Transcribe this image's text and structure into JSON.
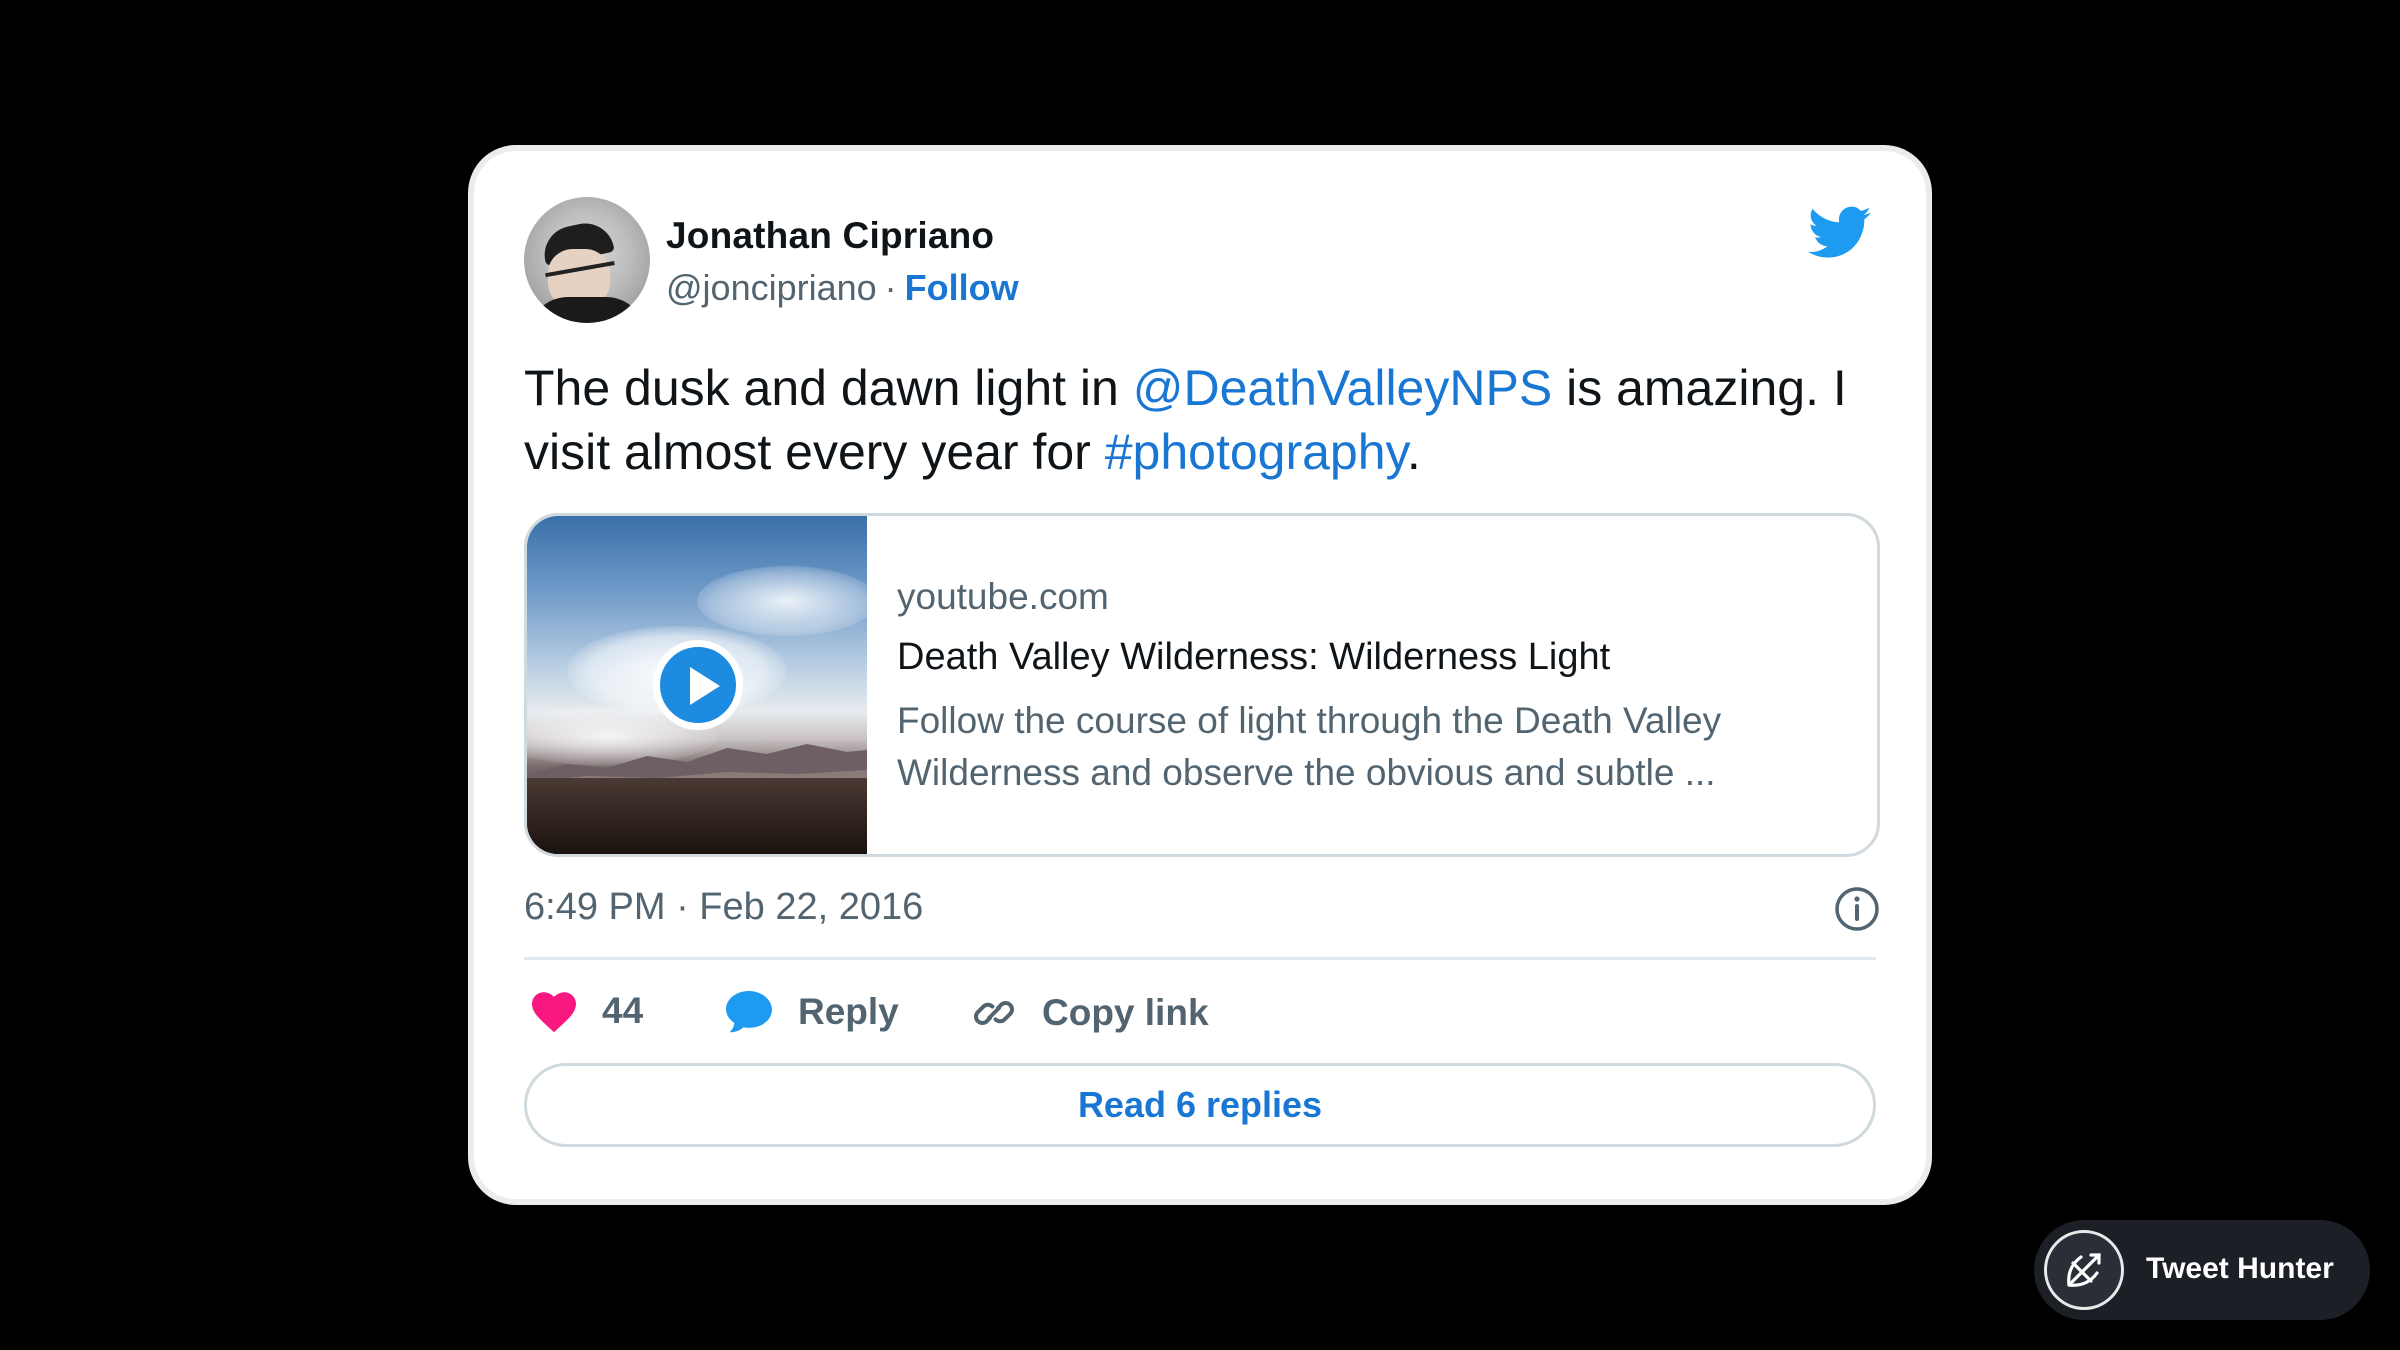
{
  "tweet": {
    "author_name": "Jonathan Cipriano",
    "handle": "@joncipriano",
    "separator": "·",
    "follow_label": "Follow",
    "text_part1": "The dusk and dawn light in ",
    "mention": "@DeathValleyNPS",
    "text_part2": " is amazing. I visit almost every year for ",
    "hashtag": "#photography",
    "text_part3": ".",
    "timestamp": "6:49 PM · Feb 22, 2016",
    "likes_count": "44",
    "reply_label": "Reply",
    "copy_link_label": "Copy link",
    "read_replies_label": "Read 6 replies"
  },
  "preview": {
    "domain": "youtube.com",
    "title": "Death Valley Wilderness: Wilderness Light",
    "description": "Follow the course of light through the Death Valley Wilderness and observe the obvious and subtle ..."
  },
  "branding": {
    "badge_label": "Tweet Hunter"
  },
  "icons": {
    "twitter": "twitter-bird-icon",
    "play": "play-icon",
    "info": "info-icon",
    "like": "heart-icon",
    "reply": "speech-bubble-icon",
    "copy": "link-icon",
    "badge": "tweet-hunter-logo-icon"
  },
  "colors": {
    "background": "#000000",
    "card": "#ffffff",
    "link_blue": "#1976d2",
    "twitter_blue": "#1d9bf0",
    "heart_pink": "#f91880",
    "muted_text": "#536471",
    "badge_bg": "#1c1f26"
  }
}
